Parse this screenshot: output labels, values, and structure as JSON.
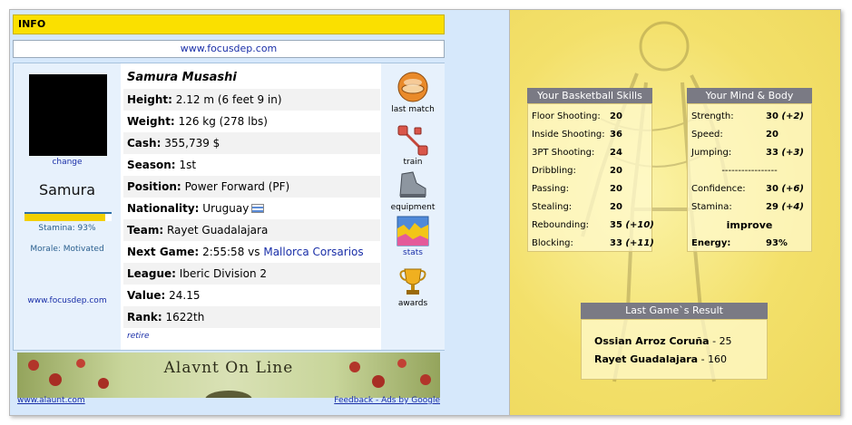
{
  "info_bar": {
    "title": "INFO"
  },
  "url_bar": {
    "text": "www.focusdep.com"
  },
  "player": {
    "avatar_change": "change",
    "name": "Samura",
    "stamina_label": "Stamina: 93%",
    "stamina_value": 93,
    "morale": "Morale: Motivated",
    "site": "www.focusdep.com"
  },
  "details": {
    "full_name": "Samura Musashi",
    "height_label": "Height:",
    "height_value": "2.12 m (6 feet 9 in)",
    "weight_label": "Weight:",
    "weight_value": "126 kg (278 lbs)",
    "cash_label": "Cash:",
    "cash_value": "355,739 $",
    "season_label": "Season:",
    "season_value": "1st",
    "position_label": "Position:",
    "position_value": "Power Forward (PF)",
    "nationality_label": "Nationality:",
    "nationality_value": "Uruguay",
    "team_label": "Team:",
    "team_value": "Rayet Guadalajara",
    "next_game_label": "Next Game:",
    "next_game_time": "2:55:58",
    "next_game_vs": "vs",
    "next_game_opponent": "Mallorca Corsarios",
    "league_label": "League:",
    "league_value": "Iberic Division 2",
    "value_label": "Value:",
    "value_value": "24.15",
    "rank_label": "Rank:",
    "rank_value": "1622th",
    "retire": "retire"
  },
  "nav_icons": [
    {
      "label": "last match",
      "icon": "ball-icon"
    },
    {
      "label": "train",
      "icon": "dumbbell-icon"
    },
    {
      "label": "equipment",
      "icon": "shoe-icon"
    },
    {
      "label": "stats",
      "icon": "stats-chart-icon"
    },
    {
      "label": "awards",
      "icon": "trophy-icon"
    }
  ],
  "banner": {
    "title": "Alavnt On Line",
    "left_link": "www.alaunt.com",
    "right_link": "Feedback - Ads by Google"
  },
  "skills": {
    "title": "Your Basketball Skills",
    "rows": [
      {
        "label": "Floor Shooting:",
        "value": "20",
        "bonus": ""
      },
      {
        "label": "Inside Shooting:",
        "value": "36",
        "bonus": ""
      },
      {
        "label": "3PT Shooting:",
        "value": "24",
        "bonus": ""
      },
      {
        "label": "Dribbling:",
        "value": "20",
        "bonus": ""
      },
      {
        "label": "Passing:",
        "value": "20",
        "bonus": ""
      },
      {
        "label": "Stealing:",
        "value": "20",
        "bonus": ""
      },
      {
        "label": "Rebounding:",
        "value": "35",
        "bonus": "(+10)"
      },
      {
        "label": "Blocking:",
        "value": "33",
        "bonus": "(+11)"
      }
    ]
  },
  "mind_body": {
    "title": "Your Mind & Body",
    "strength_label": "Strength:",
    "strength_value": "30",
    "strength_bonus": "(+2)",
    "speed_label": "Speed:",
    "speed_value": "20",
    "jumping_label": "Jumping:",
    "jumping_value": "33",
    "jumping_bonus": "(+3)",
    "divider": "-----------------",
    "confidence_label": "Confidence:",
    "confidence_value": "30",
    "confidence_bonus": "(+6)",
    "stamina_label": "Stamina:",
    "stamina_value": "29",
    "stamina_bonus": "(+4)",
    "improve": "improve",
    "energy_label": "Energy:",
    "energy_value": "93%"
  },
  "last_game": {
    "title": "Last Game`s Result",
    "team1": "Ossian Arroz Coruña",
    "sep1": " - ",
    "score1": "25",
    "team2": "Rayet Guadalajara",
    "sep2": " - ",
    "score2": "160"
  }
}
